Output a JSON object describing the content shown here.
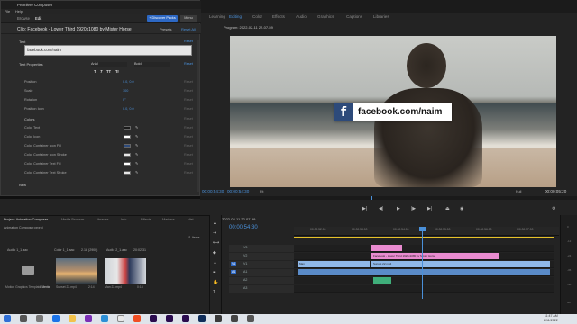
{
  "premiere": {
    "tabs": [
      "Learning",
      "Assembly",
      "Editing",
      "Color",
      "Effects",
      "Audio",
      "Graphics",
      "Captions",
      "Libraries"
    ],
    "active_tab": "Editing",
    "program_label": "Program: 2022-02-11 22-07-59",
    "tc_left": "00:00:54:30",
    "tc_program": "00:00:54:30",
    "fit": "Fit",
    "full": "Full",
    "tc_duration": "00:00:05:20"
  },
  "dialog": {
    "title": "Premiere Composer",
    "menu": [
      "File",
      "Help"
    ],
    "nav": [
      "Browse",
      "Edit"
    ],
    "nav_selected": "Edit",
    "discover": "+ Discover Packs",
    "menu_btn": "Menu",
    "clip_title": "Clip: Facebook - Lower Third 1920x1080 by Mister Horse",
    "presets": "Presets",
    "reset_all": "Reset All",
    "text_section": "Text",
    "text_value": "facebook.com/naim",
    "reset": "Reset",
    "text_props": "Text Properties",
    "font": "Arial",
    "weight": "Bold",
    "format_buttons": [
      "T",
      "T",
      "TT",
      "Tr"
    ],
    "rows": [
      {
        "label": "Position",
        "value": "0.0, 0.0"
      },
      {
        "label": "Scale",
        "value": "100"
      },
      {
        "label": "Rotation",
        "value": "0°"
      },
      {
        "label": "Position Icon",
        "value": "0.0, 0.0"
      }
    ],
    "colors_section": "Colors",
    "color_rows": [
      {
        "label": "Color Text",
        "swatch": "#1a1a1a"
      },
      {
        "label": "Color Icon",
        "swatch": "#ffffff"
      },
      {
        "label": "Color Container Icon Fill",
        "swatch": "#2d4a7a"
      },
      {
        "label": "Color Container Icon Stroke",
        "swatch": "#e6e6e6"
      },
      {
        "label": "Color Container Text Fill",
        "swatch": "#ffffff"
      },
      {
        "label": "Color Container Text Stroke",
        "swatch": "#e6e6e6"
      }
    ],
    "new_section": "New"
  },
  "lower_third": {
    "icon": "f",
    "text": "facebook.com/naim"
  },
  "project": {
    "tabs": [
      "Project: Animation Composer",
      "Media Browser",
      "Libraries",
      "Info",
      "Effects",
      "Markers",
      "Hist"
    ],
    "file": "Animation Composer.prproj",
    "count": "11 Items",
    "columns": [
      "Audio 1_1.aac",
      "Color 1_1.aac",
      "2.18 (2900)",
      "Audio 2_1.aac",
      "20:02:31"
    ],
    "thumbs": [
      {
        "caption": "Motion Graphics Template Media",
        "meta": "2 Items"
      },
      {
        "caption": "Sunset 22.mp4",
        "meta": "2:14"
      },
      {
        "caption": "Man 22.mp4",
        "meta": "0:13"
      }
    ]
  },
  "timeline": {
    "seq": "2022-02-11 22-07-59",
    "tc": "00:00:54:30",
    "ruler": [
      "00:00:52:00",
      "00:00:53:00",
      "00:00:54:00",
      "00:00:55:00",
      "00:00:56:00",
      "00:00:57:00"
    ],
    "tracks": [
      "V3",
      "V2",
      "V1",
      "A1",
      "A2",
      "A3"
    ],
    "clip_v2": "Facebook - Lower Third 1920x1080 by Mister Horse",
    "clip_v1_a": "Man",
    "clip_v1_b": "Sunset 22.mp4"
  },
  "meters": [
    "0",
    "-12",
    "-24",
    "-36",
    "-48",
    "dB"
  ],
  "taskbar": {
    "time": "11:47 AM",
    "date": "2/11/2022"
  },
  "colors": {
    "accent": "#2d68c4",
    "highlight": "#4a90d9",
    "clip_pink": "#e98bd0",
    "clip_blue": "#8fb8e8"
  }
}
